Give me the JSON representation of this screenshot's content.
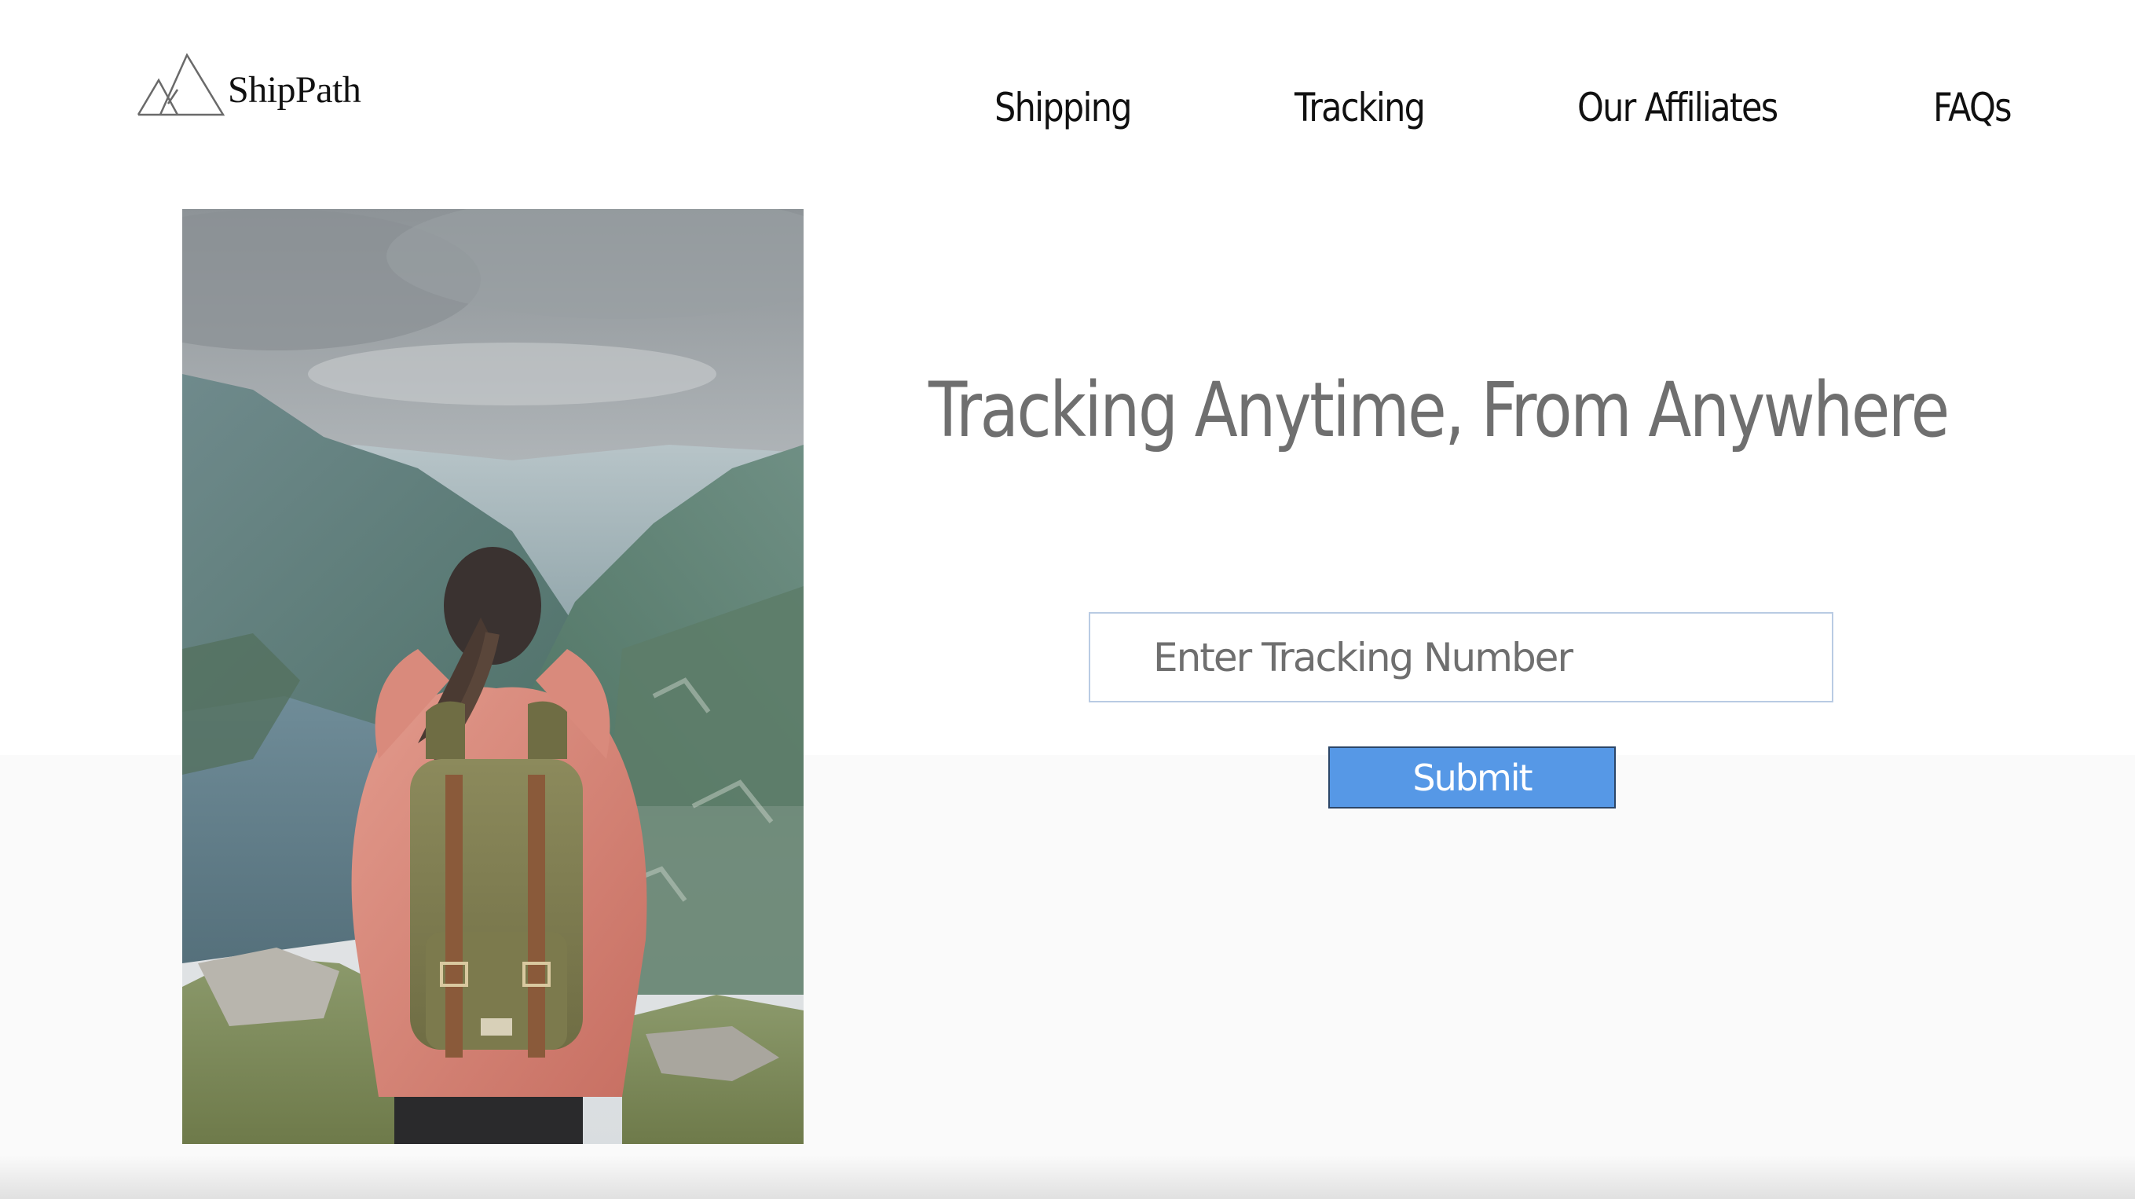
{
  "brand": {
    "name": "ShipPath",
    "logo_icon": "mountain-logo-icon"
  },
  "nav": {
    "items": [
      {
        "label": "Shipping"
      },
      {
        "label": "Tracking"
      },
      {
        "label": "Our Affiliates"
      },
      {
        "label": "FAQs"
      }
    ]
  },
  "hero": {
    "image": "hiker-in-mountain-valley-photo",
    "headline": "Tracking Anytime, From Anywhere"
  },
  "tracking_form": {
    "input_placeholder": "Enter Tracking Number",
    "input_value": "",
    "submit_label": "Submit"
  },
  "colors": {
    "accent": "#5698e6",
    "headline": "#6f6f6f",
    "input_border": "#b9cbe3"
  }
}
